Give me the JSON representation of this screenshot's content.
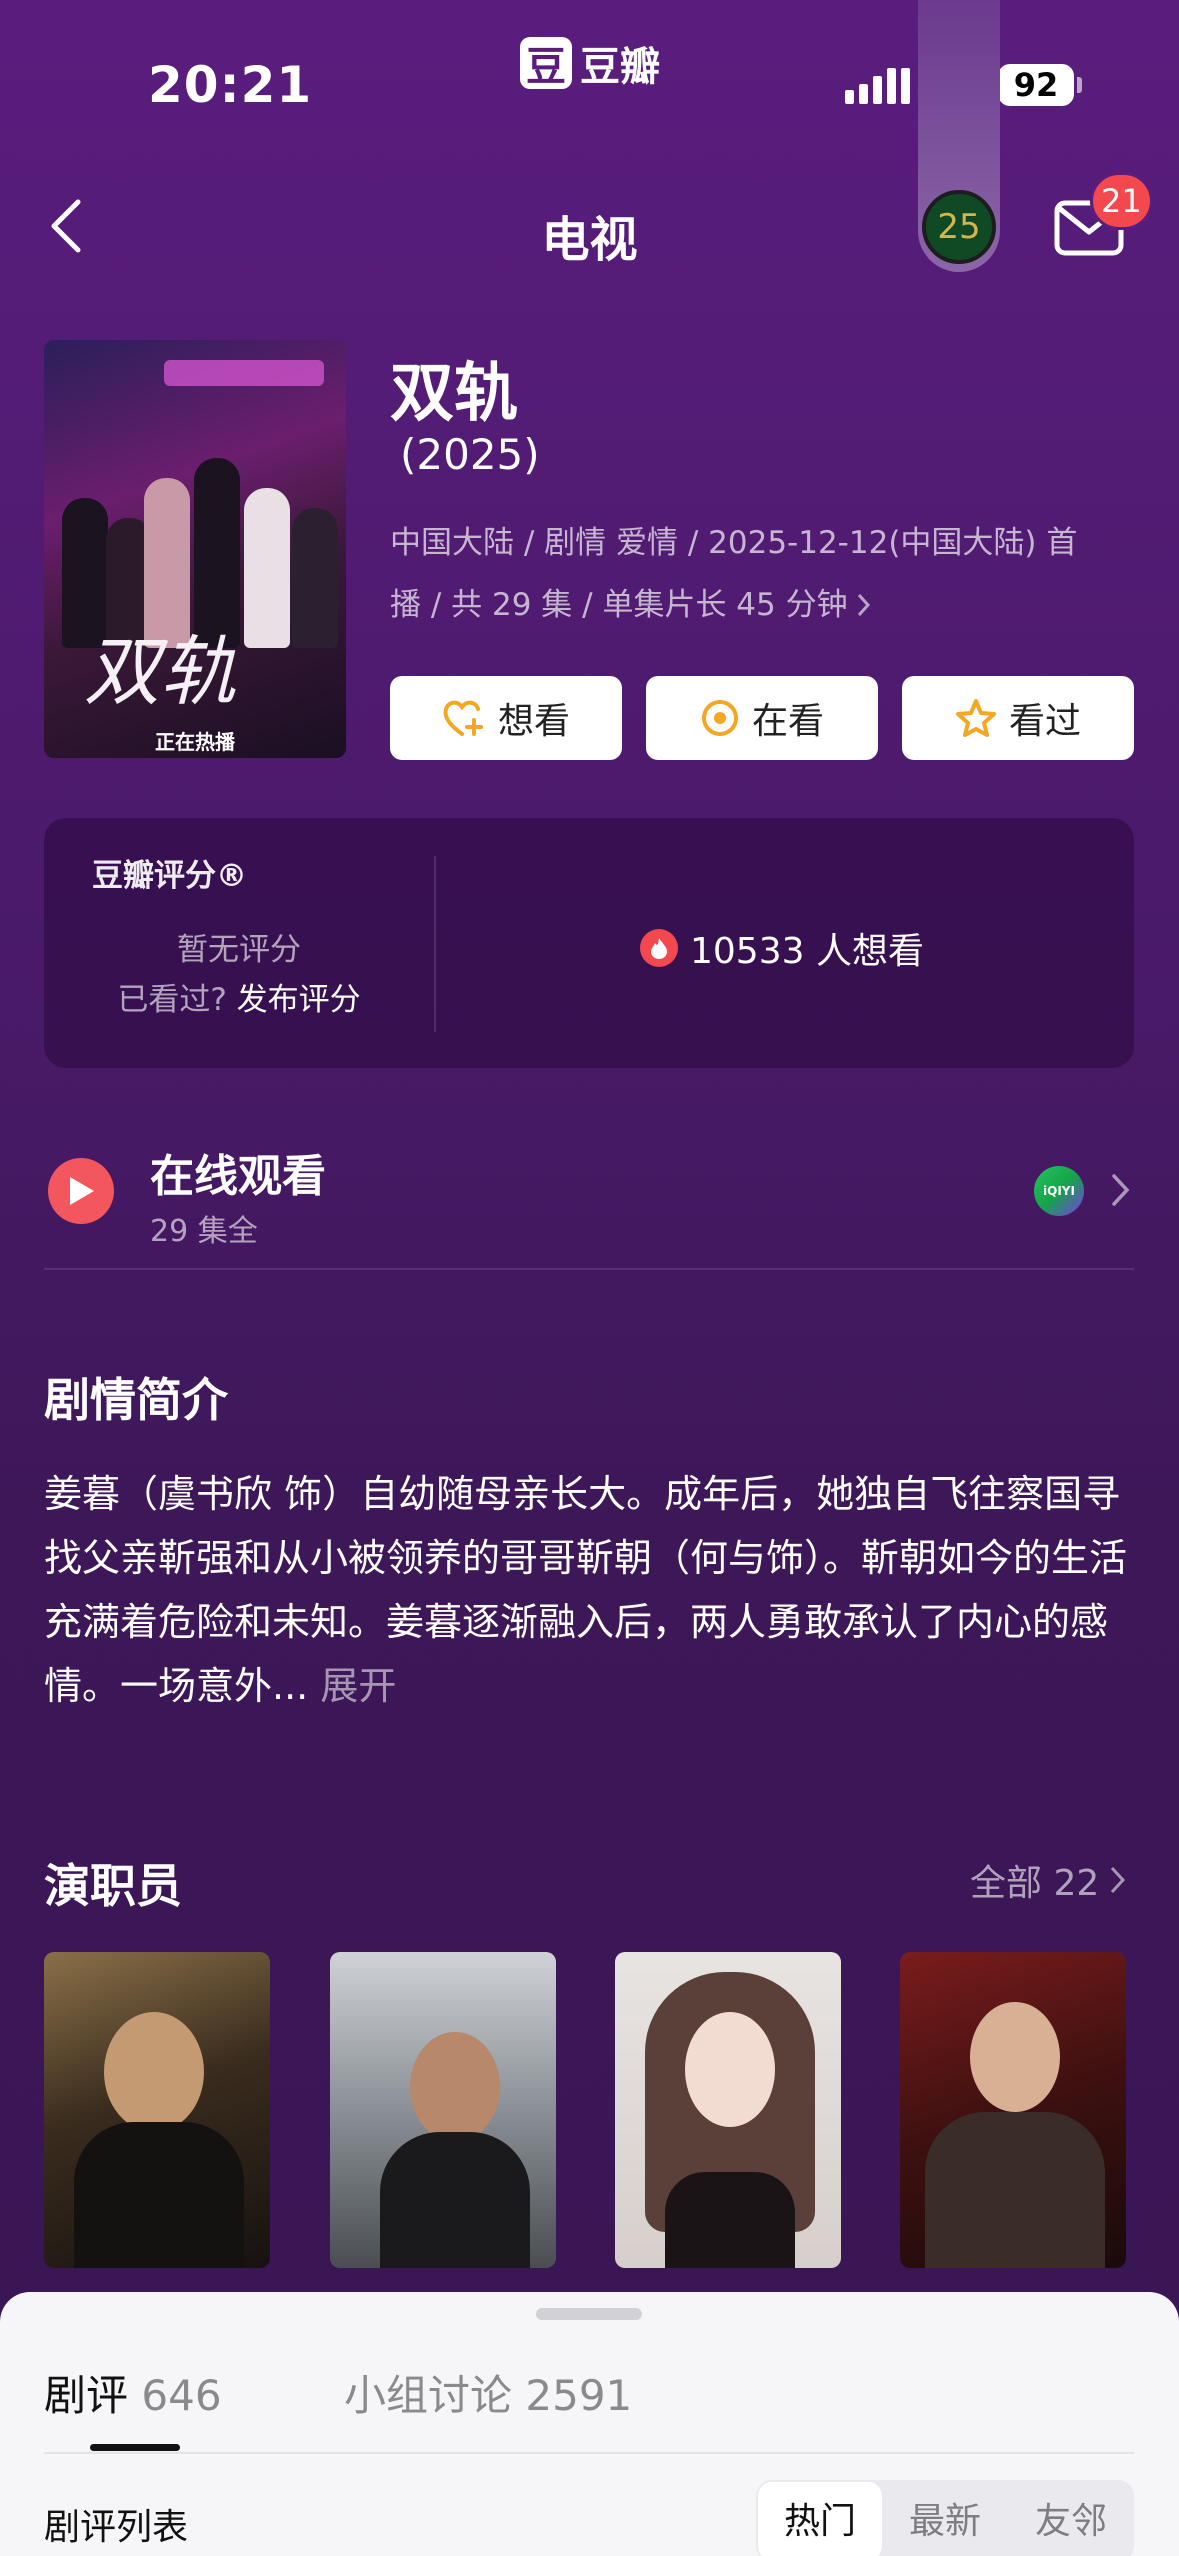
{
  "status_bar": {
    "time": "20:21",
    "battery": "92"
  },
  "brand": {
    "logo_char": "豆",
    "name": "豆瓣"
  },
  "nav": {
    "title": "电视",
    "badge_year": "25",
    "mail_count": "21"
  },
  "show": {
    "poster_title": "双轨",
    "poster_subtitle": "正在热播",
    "title": "双轨",
    "year": "(2025)",
    "meta_line1": "中国大陆 / 剧情 爱情 / 2025-12-12(中国大陆) 首",
    "meta_line2": "播 / 共 29 集 / 单集片长 45 分钟"
  },
  "actions": [
    {
      "label": "想看",
      "icon": "heart-plus-icon"
    },
    {
      "label": "在看",
      "icon": "target-icon"
    },
    {
      "label": "看过",
      "icon": "star-icon"
    }
  ],
  "rating": {
    "title": "豆瓣评分®",
    "no_rating": "暂无评分",
    "seen_prefix": "已看过?",
    "seen_action": "发布评分",
    "wish_count": "10533 人想看"
  },
  "watch": {
    "title": "在线观看",
    "subtitle": "29 集全",
    "provider_icon": "iqiyi-icon"
  },
  "synopsis": {
    "title": "剧情简介",
    "text": "姜暮（虞书欣 饰）自幼随母亲长大。成年后，她独自飞往察国寻找父亲靳强和从小被领养的哥哥靳朝（何与饰）。靳朝如今的生活充满着危险和未知。姜暮逐渐融入后，两人勇敢承认了内心的感情。一场意外...",
    "more": "展开"
  },
  "cast": {
    "title": "演职员",
    "all_label": "全部 22"
  },
  "bottom_sheet": {
    "tab_reviews": "剧评",
    "tab_reviews_count": "646",
    "tab_groups": "小组讨论",
    "tab_groups_count": "2591",
    "list_title": "剧评列表",
    "sort_options": [
      "热门",
      "最新",
      "友邻"
    ]
  },
  "colors": {
    "accent_red": "#f3565c",
    "bg_purple": "#5a1d7e",
    "sheet_bg": "#f6f6f8"
  }
}
